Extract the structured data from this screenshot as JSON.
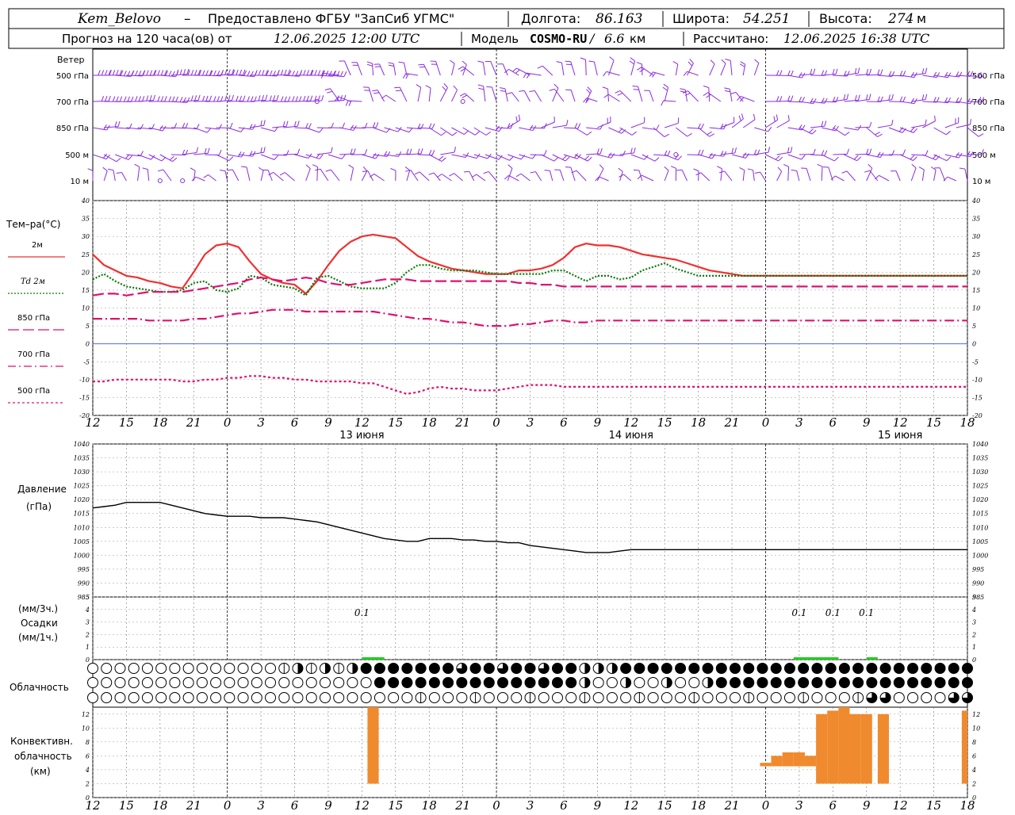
{
  "header": {
    "station": "Kem_Belovo",
    "dash": "–",
    "provider": "Предоставлено ФГБУ \"ЗапСиб УГМС\"",
    "lon_label": "Долгота:",
    "lon_value": "86.163",
    "lat_label": "Широта:",
    "lat_value": "54.251",
    "alt_label": "Высота:",
    "alt_value": "274",
    "alt_unit": "м",
    "forecast_prefix": "Прогноз на 120 часа(ов) от",
    "forecast_start": "12.06.2025 12:00 UTC",
    "model_label": "Модель",
    "model_name": "COSMO-RU",
    "model_res": "6.6",
    "model_res_unit": "км",
    "calc_label": "Рассчитано:",
    "calc_time": "12.06.2025 16:38 UTC"
  },
  "wind_panel": {
    "title": "Ветер",
    "levels": [
      "500 гПа",
      "700 гПа",
      "850 гПа",
      "500 м",
      "10 м"
    ],
    "levels_right": [
      "500 гПа",
      "700 гПа",
      "850 гПа",
      "500 м",
      "10 м"
    ],
    "color": "#8a2be2"
  },
  "temp_panel": {
    "title": "Тем–ра(°С)",
    "legend": [
      {
        "label": "2м",
        "color": "#f03030",
        "style": "solid"
      },
      {
        "label": "Td  2м",
        "color": "#0a7a0a",
        "style": "dotted"
      },
      {
        "label": "850 гПа",
        "color": "#e0106e",
        "style": "long-dash"
      },
      {
        "label": "700 гПа",
        "color": "#e0106e",
        "style": "dash-dot"
      },
      {
        "label": "500 гПа",
        "color": "#e0106e",
        "style": "short-dash"
      }
    ]
  },
  "pressure_panel": {
    "title_1": "Давление",
    "title_2": "(гПа)"
  },
  "precip_panel": {
    "label_1": "(мм/3ч.)",
    "label_2": "Осадки",
    "label_3": "(мм/1ч.)",
    "annotations": [
      {
        "h": 24,
        "text": "0.1"
      },
      {
        "h": 63,
        "text": "0.1"
      },
      {
        "h": 66,
        "text": "0.1"
      },
      {
        "h": 69,
        "text": "0.1"
      }
    ]
  },
  "cloud_panel": {
    "title": "Облачность"
  },
  "conv_panel": {
    "title_1": "Конвективн.",
    "title_2": "облачность",
    "title_3": "(км)"
  },
  "time_axis": {
    "hour_labels": [
      "12",
      "15",
      "18",
      "21",
      "0",
      "3",
      "6",
      "9",
      "12",
      "15",
      "18",
      "21",
      "0",
      "3",
      "6",
      "9",
      "12",
      "15",
      "18",
      "21",
      "0",
      "3",
      "6",
      "9",
      "12",
      "15",
      "18"
    ],
    "day_labels": [
      {
        "h": 24,
        "text": "13 июня"
      },
      {
        "h": 48,
        "text": "14 июня"
      },
      {
        "h": 72,
        "text": "15 июня"
      }
    ]
  },
  "chart_data": [
    {
      "type": "line",
      "panel": "temperature",
      "x_hours_from_start": [
        0,
        1,
        2,
        3,
        4,
        5,
        6,
        7,
        8,
        9,
        10,
        11,
        12,
        13,
        14,
        15,
        16,
        17,
        18,
        19,
        20,
        21,
        22,
        23,
        24,
        25,
        26,
        27,
        28,
        29,
        30,
        31,
        32,
        33,
        34,
        35,
        36,
        37,
        38,
        39,
        40,
        41,
        42,
        43,
        44,
        45,
        46,
        47,
        48,
        49,
        50,
        51,
        52,
        53,
        54,
        55,
        56,
        57,
        58,
        59,
        60,
        61,
        62,
        63,
        64,
        65,
        66,
        67,
        68,
        69,
        70,
        71,
        72,
        73,
        74,
        75,
        76,
        77,
        78
      ],
      "ylim": [
        -20,
        40
      ],
      "y_ticks": [
        -20,
        -15,
        -10,
        -5,
        0,
        5,
        10,
        15,
        20,
        25,
        30,
        35,
        40
      ],
      "series": [
        {
          "name": "2м",
          "color": "#f03030",
          "values": [
            25,
            22,
            20.5,
            19,
            18.5,
            17.5,
            17,
            16,
            15.5,
            20,
            25,
            27.5,
            28,
            27,
            23,
            19.5,
            18,
            17,
            16.5,
            14,
            17.5,
            22,
            26,
            28.5,
            30,
            30.5,
            30,
            29.5,
            27,
            24.5,
            23,
            22,
            21,
            20.5,
            20,
            19.5,
            19.5,
            19.5,
            20.5,
            20.5,
            21,
            22,
            24,
            27,
            28,
            27.5,
            27.5,
            27,
            26,
            25,
            24.5,
            24,
            23.5,
            22.5,
            21.5,
            20.5,
            20,
            19.5,
            19,
            19,
            19,
            19,
            19,
            19,
            19,
            19,
            19,
            19,
            19,
            19,
            19,
            19,
            19,
            19,
            19,
            19,
            19,
            19,
            19
          ]
        },
        {
          "name": "Td 2м",
          "color": "#0a7a0a",
          "values": [
            18,
            19.5,
            17.5,
            16,
            15.5,
            15,
            14.5,
            14.5,
            15,
            17,
            17.5,
            15,
            14.5,
            15.5,
            19,
            18.5,
            16.5,
            16,
            15.5,
            13.5,
            18.5,
            19,
            17.5,
            16,
            15.5,
            15.5,
            15.5,
            17,
            20,
            22,
            22,
            21,
            20.5,
            20.5,
            20.5,
            20,
            19.5,
            19.5,
            19.5,
            19.5,
            19.5,
            20.5,
            20.5,
            19,
            17.5,
            19,
            19,
            18,
            18.5,
            20.5,
            21.5,
            22.5,
            21,
            20,
            19,
            19,
            19,
            19,
            19,
            19,
            19,
            19,
            19,
            19,
            19,
            19,
            19,
            19,
            19,
            19,
            19,
            19,
            19,
            19,
            19,
            19,
            19,
            19,
            19
          ]
        },
        {
          "name": "850 гПа",
          "color": "#e0106e",
          "values": [
            13.5,
            14,
            14,
            13.5,
            14,
            14.5,
            14.5,
            14.5,
            14.5,
            15,
            15.5,
            16,
            16.5,
            17,
            18,
            18.5,
            18,
            17.5,
            18,
            18.5,
            18,
            17,
            16.5,
            16.5,
            17,
            17.5,
            18,
            18,
            18,
            17.5,
            17.5,
            17.5,
            17.5,
            17.5,
            17.5,
            17.5,
            17.5,
            17.5,
            17,
            17,
            16.5,
            16.5,
            16,
            16,
            16,
            16,
            16,
            16,
            16,
            16,
            16,
            16,
            16,
            16,
            16,
            16,
            16,
            16,
            16,
            16,
            16,
            16,
            16,
            16,
            16,
            16,
            16,
            16,
            16,
            16,
            16,
            16,
            16,
            16,
            16,
            16,
            16,
            16,
            16
          ]
        },
        {
          "name": "700 гПа",
          "color": "#e0106e",
          "values": [
            7,
            7,
            7,
            7,
            7,
            6.5,
            6.5,
            6.5,
            6.5,
            7,
            7,
            7.5,
            8,
            8.5,
            8.5,
            9,
            9.5,
            9.5,
            9.5,
            9,
            9,
            9,
            9,
            9,
            9,
            9,
            8.5,
            8,
            7.5,
            7,
            7,
            6.5,
            6,
            6,
            5.5,
            5,
            5,
            5,
            5.5,
            5.5,
            6,
            6.5,
            6.5,
            6,
            6,
            6.5,
            6.5,
            6.5,
            6.5,
            6.5,
            6.5,
            6.5,
            6.5,
            6.5,
            6.5,
            6.5,
            6.5,
            6.5,
            6.5,
            6.5,
            6.5,
            6.5,
            6.5,
            6.5,
            6.5,
            6.5,
            6.5,
            6.5,
            6.5,
            6.5,
            6.5,
            6.5,
            6.5,
            6.5,
            6.5,
            6.5,
            6.5,
            6.5,
            6.5
          ]
        },
        {
          "name": "500 гПа",
          "color": "#e0106e",
          "values": [
            -10.5,
            -10.5,
            -10,
            -10,
            -10,
            -10,
            -10,
            -10,
            -10.5,
            -10.5,
            -10,
            -10,
            -9.5,
            -9.5,
            -9,
            -9,
            -9.5,
            -9.5,
            -10,
            -10,
            -10.5,
            -10.5,
            -10.5,
            -10.5,
            -11,
            -11,
            -12,
            -13,
            -14,
            -13.5,
            -12.5,
            -12,
            -12.5,
            -12.5,
            -13,
            -13,
            -13,
            -12.5,
            -12,
            -11.5,
            -11.5,
            -11.5,
            -12,
            -12,
            -12,
            -12,
            -12,
            -12,
            -12,
            -12,
            -12,
            -12,
            -12,
            -12,
            -12,
            -12,
            -12,
            -12,
            -12,
            -12,
            -12,
            -12,
            -12,
            -12,
            -12,
            -12,
            -12,
            -12,
            -12,
            -12,
            -12,
            -12,
            -12,
            -12,
            -12,
            -12,
            -12,
            -12,
            -12
          ]
        }
      ]
    },
    {
      "type": "line",
      "panel": "pressure",
      "ylim": [
        985,
        1040
      ],
      "y_ticks": [
        985,
        990,
        995,
        1000,
        1005,
        1010,
        1015,
        1020,
        1025,
        1030,
        1035,
        1040
      ],
      "series": [
        {
          "name": "",
          "color": "#000000",
          "values": [
            1017,
            1017.5,
            1018,
            1019,
            1019,
            1019,
            1019,
            1018,
            1017,
            1016,
            1015,
            1014.5,
            1014,
            1014,
            1014,
            1013.5,
            1013.5,
            1013.5,
            1013,
            1012.5,
            1012,
            1011,
            1010,
            1009,
            1008,
            1007,
            1006,
            1005.5,
            1005,
            1005,
            1006,
            1006,
            1006,
            1005.5,
            1005.5,
            1005,
            1005,
            1004.5,
            1004.5,
            1003.5,
            1003,
            1002.5,
            1002,
            1001.5,
            1001,
            1001,
            1001,
            1001.5,
            1002,
            1002,
            1002,
            1002,
            1002,
            1002,
            1002,
            1002,
            1002,
            1002,
            1002,
            1002,
            1002,
            1002,
            1002,
            1002,
            1002,
            1002,
            1002,
            1002,
            1002,
            1002,
            1002,
            1002,
            1002,
            1002,
            1002,
            1002,
            1002,
            1002,
            1002
          ]
        }
      ]
    },
    {
      "type": "bar",
      "panel": "precipitation",
      "ylim": [
        0,
        5
      ],
      "y_ticks": [
        0,
        1,
        2,
        3,
        4,
        5
      ],
      "bars": [
        {
          "h0": 24,
          "h1": 26,
          "value": 0.1
        },
        {
          "h0": 62.5,
          "h1": 66.5,
          "value": 0.1
        },
        {
          "h0": 69,
          "h1": 70,
          "value": 0.1
        }
      ],
      "bar_color": "#1bd31b"
    },
    {
      "type": "bar",
      "panel": "convective_cloud",
      "ylim": [
        0,
        13
      ],
      "y_ticks": [
        0,
        2,
        4,
        6,
        8,
        10,
        12
      ],
      "bar_color": "#f08a2e",
      "bars": [
        {
          "h0": 24.5,
          "h1": 25.5,
          "bottom": 2,
          "top": 13
        },
        {
          "h0": 59.5,
          "h1": 60.5,
          "bottom": 4.5,
          "top": 5
        },
        {
          "h0": 60.5,
          "h1": 61.5,
          "bottom": 4.5,
          "top": 6
        },
        {
          "h0": 61.5,
          "h1": 62.5,
          "bottom": 4.5,
          "top": 6.5
        },
        {
          "h0": 62.5,
          "h1": 63.5,
          "bottom": 4.5,
          "top": 6.5
        },
        {
          "h0": 63.5,
          "h1": 64.5,
          "bottom": 4.5,
          "top": 6
        },
        {
          "h0": 64.5,
          "h1": 65.5,
          "bottom": 2,
          "top": 12
        },
        {
          "h0": 65.5,
          "h1": 66.5,
          "bottom": 2,
          "top": 12.5
        },
        {
          "h0": 66.5,
          "h1": 67.5,
          "bottom": 2,
          "top": 13
        },
        {
          "h0": 67.5,
          "h1": 68.5,
          "bottom": 2,
          "top": 12
        },
        {
          "h0": 68.5,
          "h1": 69.5,
          "bottom": 2,
          "top": 12
        },
        {
          "h0": 70,
          "h1": 71,
          "bottom": 2,
          "top": 12
        },
        {
          "h0": 77.5,
          "h1": 78,
          "bottom": 2,
          "top": 12.5
        }
      ]
    }
  ]
}
